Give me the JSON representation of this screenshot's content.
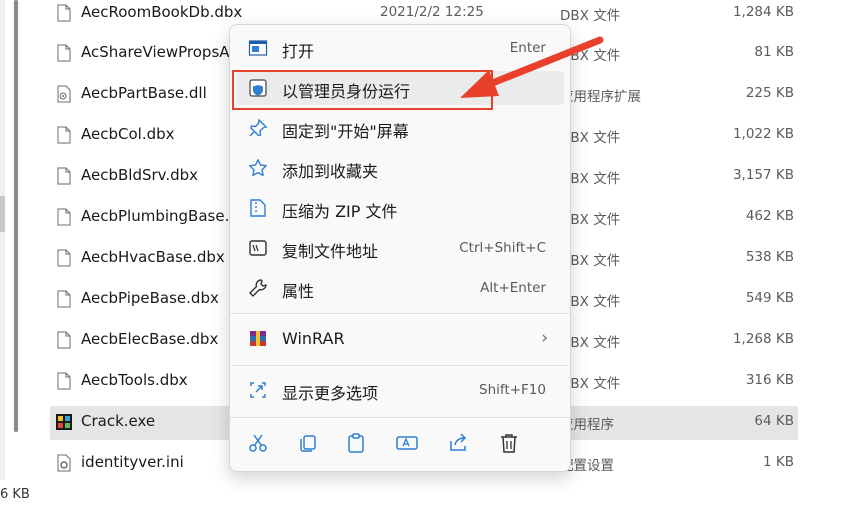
{
  "files": [
    {
      "name": "AecRoomBookDb.dbx",
      "date": "2021/2/2 12:25",
      "type": "DBX 文件",
      "size": "1,284 KB",
      "icon": "file-icon"
    },
    {
      "name": "AcShareViewPropsA",
      "date": "",
      "type": "DBX 文件",
      "size": "81 KB",
      "icon": "file-icon"
    },
    {
      "name": "AecbPartBase.dll",
      "date": "",
      "type": "应用程序扩展",
      "size": "225 KB",
      "icon": "dll-icon"
    },
    {
      "name": "AecbCol.dbx",
      "date": "",
      "type": "DBX 文件",
      "size": "1,022 KB",
      "icon": "file-icon"
    },
    {
      "name": "AecbBldSrv.dbx",
      "date": "",
      "type": "DBX 文件",
      "size": "3,157 KB",
      "icon": "file-icon"
    },
    {
      "name": "AecbPlumbingBase.dbx",
      "date": "",
      "type": "DBX 文件",
      "size": "462 KB",
      "icon": "file-icon"
    },
    {
      "name": "AecbHvacBase.dbx",
      "date": "",
      "type": "DBX 文件",
      "size": "538 KB",
      "icon": "file-icon"
    },
    {
      "name": "AecbPipeBase.dbx",
      "date": "",
      "type": "DBX 文件",
      "size": "549 KB",
      "icon": "file-icon"
    },
    {
      "name": "AecbElecBase.dbx",
      "date": "",
      "type": "DBX 文件",
      "size": "1,268 KB",
      "icon": "file-icon"
    },
    {
      "name": "AecbTools.dbx",
      "date": "",
      "type": "DBX 文件",
      "size": "316 KB",
      "icon": "file-icon"
    },
    {
      "name": "Crack.exe",
      "date": "",
      "type": "应用程序",
      "size": "64 KB",
      "icon": "exe-icon",
      "selected": true
    },
    {
      "name": "identityver.ini",
      "date": "",
      "type": "配置设置",
      "size": "1 KB",
      "icon": "ini-icon"
    }
  ],
  "status": {
    "size": "6 KB"
  },
  "menu": {
    "items": [
      {
        "label": "打开",
        "shortcut": "Enter",
        "icon": "open-app-icon"
      },
      {
        "label": "以管理员身份运行",
        "shortcut": "",
        "icon": "shield-icon"
      },
      {
        "label": "固定到\"开始\"屏幕",
        "shortcut": "",
        "icon": "pin-icon"
      },
      {
        "label": "添加到收藏夹",
        "shortcut": "",
        "icon": "star-icon"
      },
      {
        "label": "压缩为 ZIP 文件",
        "shortcut": "",
        "icon": "zip-icon"
      },
      {
        "label": "复制文件地址",
        "shortcut": "Ctrl+Shift+C",
        "icon": "copy-path-icon"
      },
      {
        "label": "属性",
        "shortcut": "Alt+Enter",
        "icon": "wrench-icon"
      },
      {
        "label": "WinRAR",
        "shortcut": "",
        "icon": "winrar-icon",
        "submenu": true
      },
      {
        "label": "显示更多选项",
        "shortcut": "Shift+F10",
        "icon": "more-options-icon"
      }
    ],
    "quick_actions": [
      "cut-icon",
      "copy-icon",
      "paste-icon",
      "rename-icon",
      "share-icon",
      "delete-icon"
    ]
  },
  "colors": {
    "accent": "#0067c0",
    "highlight": "#e8402a",
    "selected_row": "#e5e5e5"
  }
}
